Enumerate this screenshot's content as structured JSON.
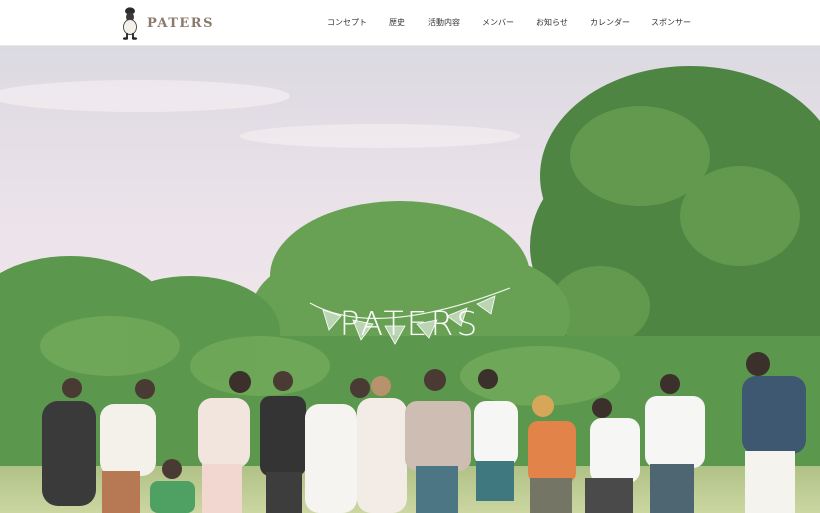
{
  "brand": {
    "name": "PATERS",
    "logo_icon": "sheep-mascot-icon"
  },
  "nav": {
    "items": [
      {
        "label": "コンセプト"
      },
      {
        "label": "歴史"
      },
      {
        "label": "活動内容"
      },
      {
        "label": "メンバー"
      },
      {
        "label": "お知らせ"
      },
      {
        "label": "カレンダー"
      },
      {
        "label": "スポンサー"
      }
    ]
  },
  "hero": {
    "title": "PATERS",
    "decoration": "bunting-flags-icon",
    "image": "group-photo-in-park"
  },
  "colors": {
    "logo_text": "#8a7a6a",
    "nav_text": "#333333",
    "sky": "#e9dfe8",
    "foliage": "#4f8a3c",
    "grass": "#b9c98c"
  }
}
